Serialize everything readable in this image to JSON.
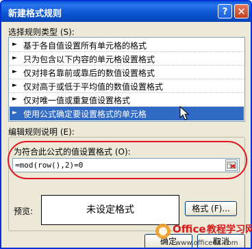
{
  "window": {
    "title": "新建格式规则",
    "help_label": "?",
    "close_label": "✕"
  },
  "rule_type": {
    "label": "选择规则类型 (S):",
    "items": [
      {
        "label": "基于各自值设置所有单元格的格式",
        "selected": false
      },
      {
        "label": "只为包含以下内容的单元格设置格式",
        "selected": false
      },
      {
        "label": "仅对排名靠前或靠后的数值设置格式",
        "selected": false
      },
      {
        "label": "仅对高于或低于平均值的数值设置格式",
        "selected": false
      },
      {
        "label": "仅对唯一值或重复值设置格式",
        "selected": false
      },
      {
        "label": "使用公式确定要设置格式的单元格",
        "selected": true
      }
    ],
    "arrow_glyph": "►"
  },
  "edit": {
    "label": "编辑规则说明 (E):",
    "formula_label": "为符合此公式的值设置格式 (O):",
    "formula_value": "=mod(row(),2)=0",
    "preview_label": "预览:",
    "preview_text": "未设定格式",
    "format_button": "格式 (F)...",
    "highlight_color": "#e0141e"
  },
  "footer": {
    "ok_label": "确定",
    "cancel_label": "取消"
  },
  "watermark": {
    "text": "Office教程学习网",
    "url": "www.office68.com"
  },
  "colors": {
    "title_bar": "#0a55d0",
    "selection": "#316ac5",
    "dialog_bg": "#ece9d8"
  }
}
